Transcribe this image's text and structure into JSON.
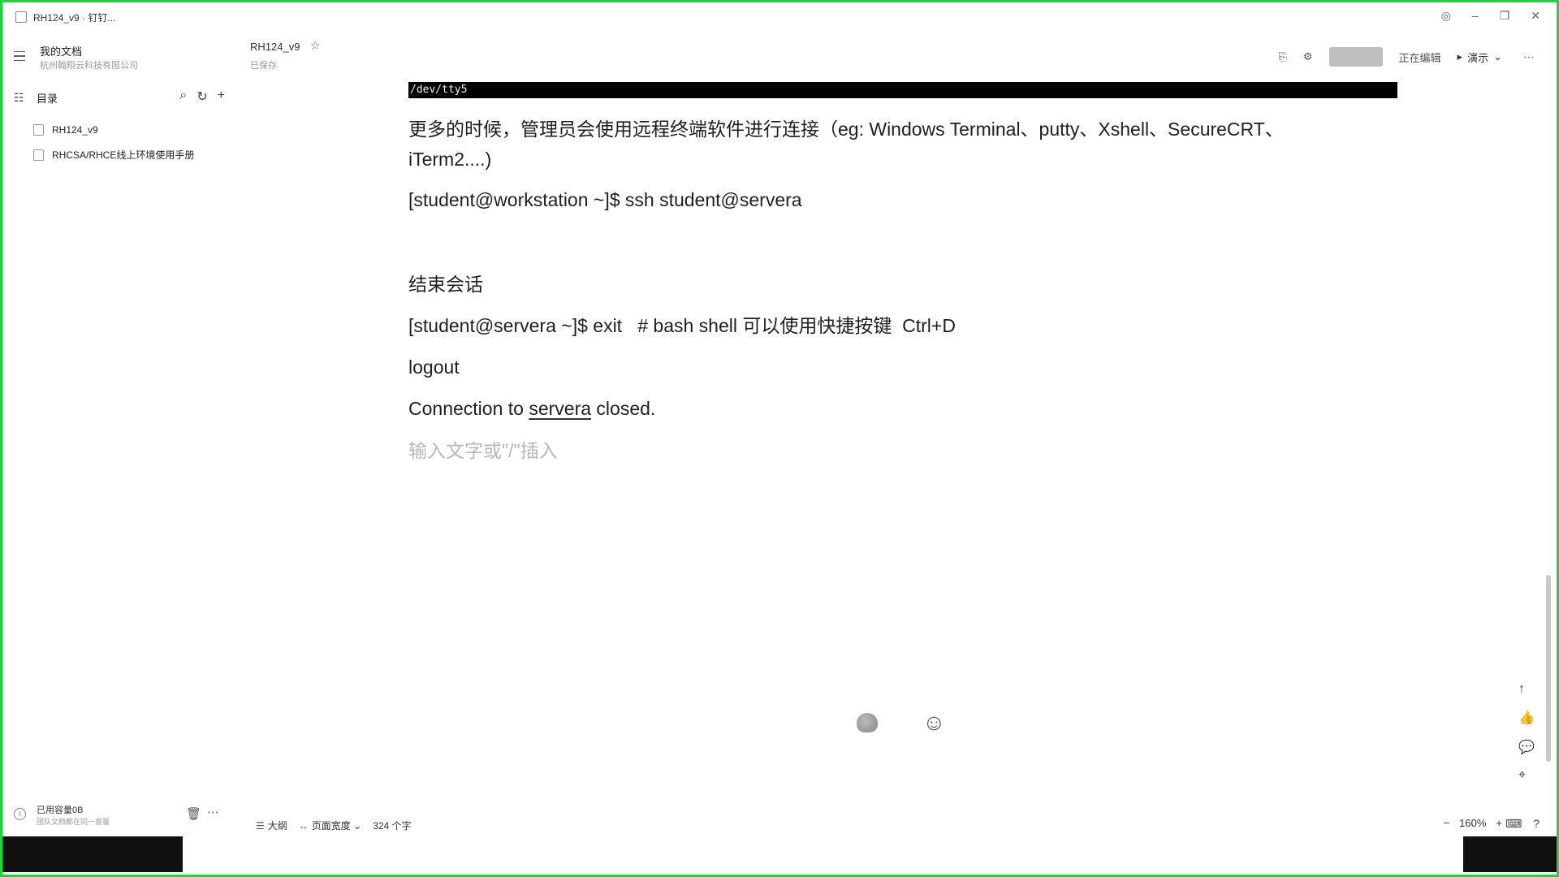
{
  "window": {
    "title": "RH124_v9 · 钉钉...",
    "controls": [
      "◎",
      "–",
      "❐",
      "✕"
    ]
  },
  "sidebar": {
    "workspace_name": "我的文档",
    "workspace_org": "杭州翰翔云科技有限公司",
    "toc_title": "目录",
    "items": [
      {
        "label": "RH124_v9"
      },
      {
        "label": "RHCSA/RHCE线上环境使用手册"
      }
    ],
    "storage_used": "已用容量0B",
    "storage_note": "团队文档都在同一容量"
  },
  "doc": {
    "title": "RH124_v9",
    "saved_status": "已保存",
    "present_label": "演示",
    "editing_label": "正在编辑"
  },
  "content": {
    "terminal_text": "/dev/tty5",
    "line1": "更多的时候，管理员会使用远程终端软件进行连接（eg: Windows Terminal、putty、Xshell、SecureCRT、",
    "line2": "iTerm2....)",
    "line3": "[student@workstation ~]$ ssh student@servera",
    "heading": "结束会话",
    "line4": "[student@servera ~]$ exit   # bash shell 可以使用快捷按键  Ctrl+D",
    "line5": "logout",
    "line6_prefix": "Connection to ",
    "line6_host": "servera",
    "line6_suffix": " closed.",
    "placeholder": "输入文字或\"/\"插入"
  },
  "statusbar": {
    "outline_label": "大纲",
    "page_width_label": "页面宽度",
    "word_count": "324 个字",
    "zoom": "160%"
  },
  "icons": {
    "accent_border": "#19d63a"
  }
}
